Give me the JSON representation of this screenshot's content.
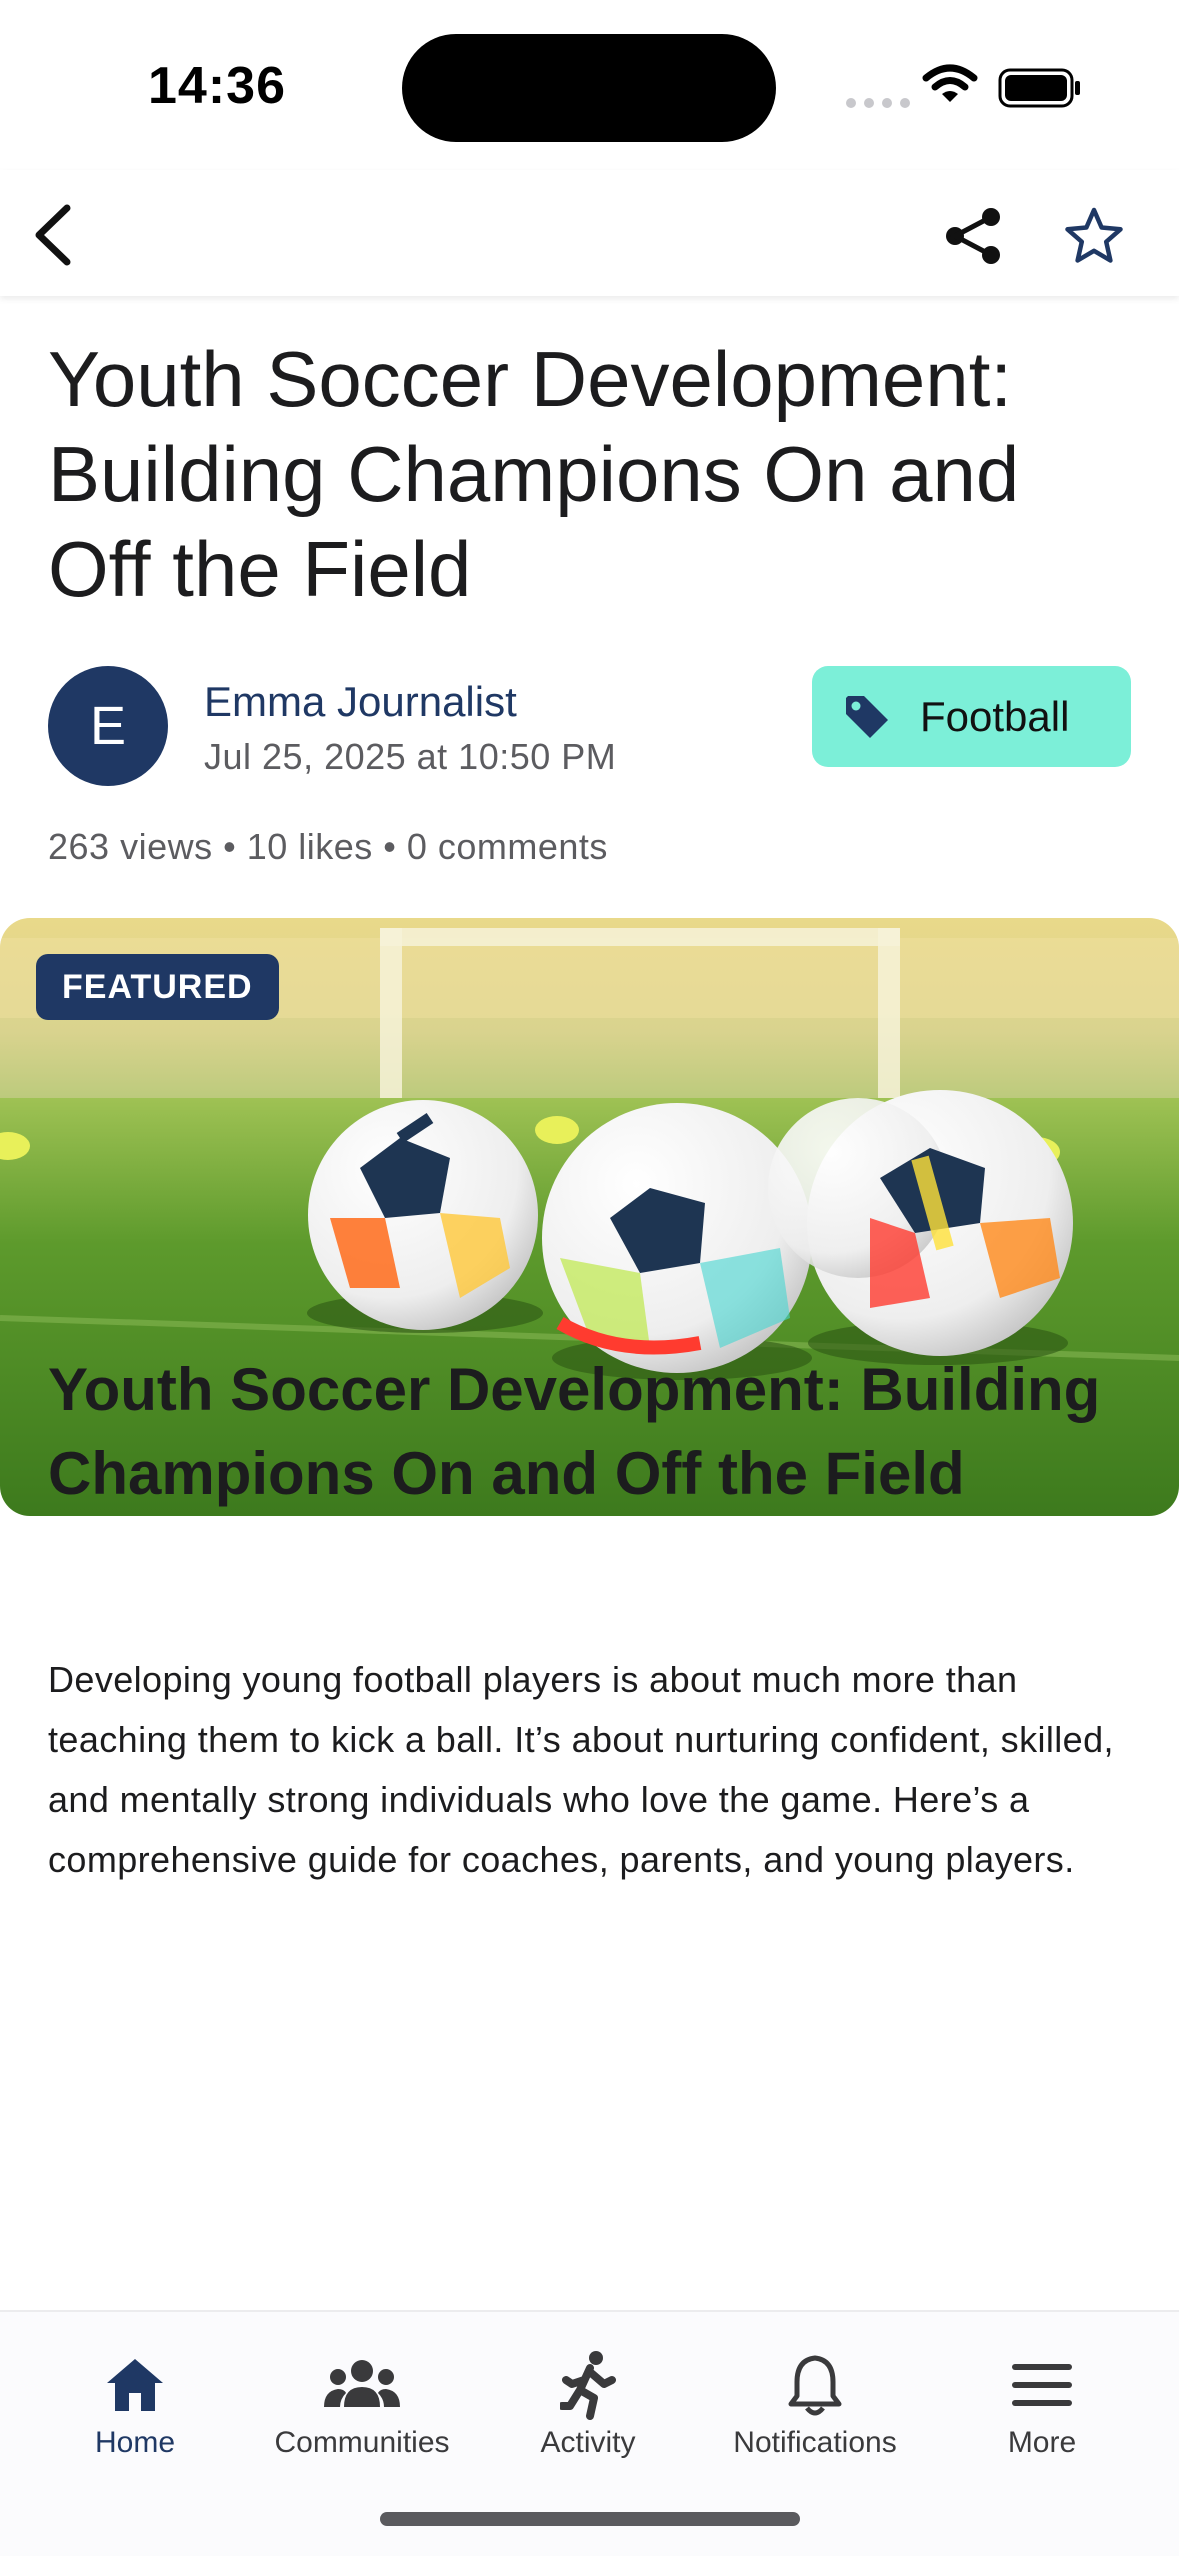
{
  "status_bar": {
    "time": "14:36"
  },
  "header": {
    "back_icon": "chevron-left-icon",
    "share_icon": "share-icon",
    "bookmark_icon": "star-outline-icon"
  },
  "article": {
    "title": "Youth Soccer Development: Building Champions On and Off the Field",
    "author": {
      "initial": "E",
      "name": "Emma Journalist",
      "date": "Jul 25, 2025 at 10:50 PM"
    },
    "tag": {
      "icon": "tag-icon",
      "label": "Football",
      "color": "#7cefd8"
    },
    "stats": "263 views • 10 likes • 0 comments",
    "hero": {
      "badge": "FEATURED",
      "image": "soccer balls on grass field"
    },
    "section_heading": "Youth Soccer Development: Building Champions On and Off the Field",
    "body": "Developing young football players is about much more than teaching them to kick a ball. It’s about nurturing confident, skilled, and mentally strong individuals who love the game. Here’s a comprehensive guide for coaches, parents, and young players."
  },
  "tab_bar": {
    "accent": "#1f3864",
    "items": [
      {
        "label": "Home",
        "icon": "home-icon",
        "active": true
      },
      {
        "label": "Communities",
        "icon": "people-icon",
        "active": false
      },
      {
        "label": "Activity",
        "icon": "running-icon",
        "active": false
      },
      {
        "label": "Notifications",
        "icon": "bell-icon",
        "active": false
      },
      {
        "label": "More",
        "icon": "menu-icon",
        "active": false
      }
    ]
  }
}
